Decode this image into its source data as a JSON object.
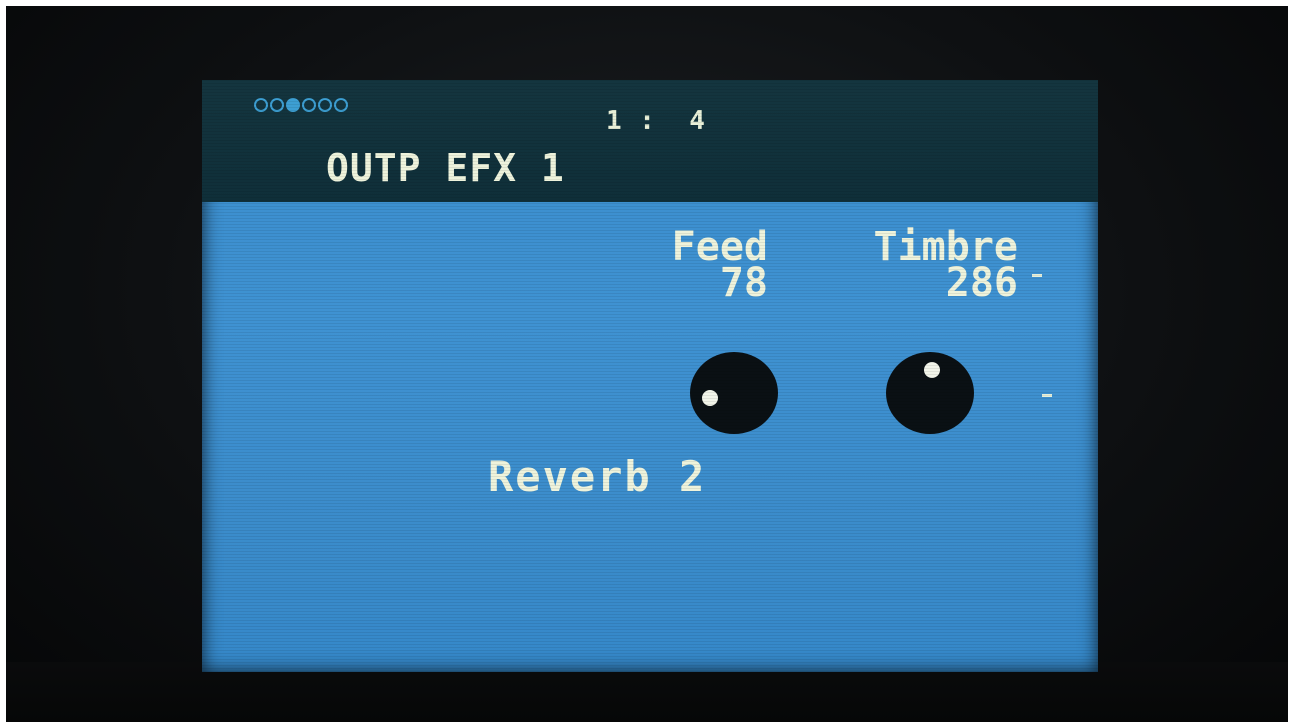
{
  "header": {
    "page_dots": [
      false,
      false,
      true,
      false,
      false,
      false
    ],
    "position": "1 :  4",
    "title": "OUTP EFX 1"
  },
  "params": [
    {
      "label": "Feed",
      "value": "78"
    },
    {
      "label": "Timbre",
      "value": "286"
    }
  ],
  "effect": {
    "name": "Reverb 2"
  },
  "colors": {
    "screen": "#3b8dcc",
    "header": "#12323c",
    "text": "#eef3dc",
    "knob": "#0a1014"
  }
}
